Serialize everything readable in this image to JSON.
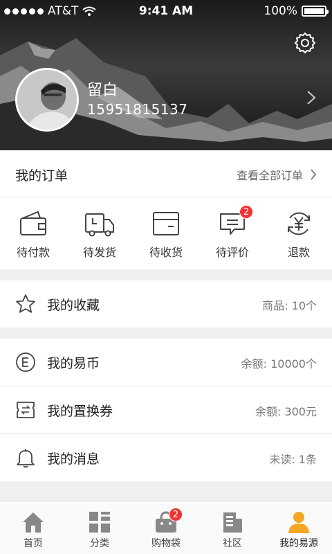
{
  "status_bar": {
    "carrier": "AT&T",
    "time": "9:41 AM",
    "battery": "100%"
  },
  "profile": {
    "name": "留白",
    "phone": "15951815137"
  },
  "orders": {
    "title": "我的订单",
    "view_all": "查看全部订单",
    "items": [
      {
        "label": "待付款",
        "icon": "wallet-icon",
        "badge": null
      },
      {
        "label": "待发货",
        "icon": "truck-icon",
        "badge": null
      },
      {
        "label": "待收货",
        "icon": "box-icon",
        "badge": null
      },
      {
        "label": "待评价",
        "icon": "comment-icon",
        "badge": "2"
      },
      {
        "label": "退款",
        "icon": "yen-refresh-icon",
        "badge": null
      }
    ]
  },
  "rows": [
    {
      "title": "我的收藏",
      "value": "商品: 10个",
      "icon": "star-icon"
    },
    {
      "title": "我的易币",
      "value": "余额: 10000个",
      "icon": "coin-e-icon"
    },
    {
      "title": "我的置换券",
      "value": "余额: 300元",
      "icon": "ticket-icon"
    },
    {
      "title": "我的消息",
      "value": "未读: 1条",
      "icon": "bell-icon"
    }
  ],
  "tabbar": {
    "items": [
      {
        "label": "首页",
        "icon": "home-icon"
      },
      {
        "label": "分类",
        "icon": "grid-icon"
      },
      {
        "label": "购物袋",
        "icon": "bag-icon",
        "badge": "2"
      },
      {
        "label": "社区",
        "icon": "building-icon"
      },
      {
        "label": "我的易源",
        "icon": "person-icon",
        "active": true
      }
    ]
  },
  "colors": {
    "accent": "#f5a623",
    "badge": "#f23232",
    "text": "#222222",
    "muted": "#777777"
  }
}
